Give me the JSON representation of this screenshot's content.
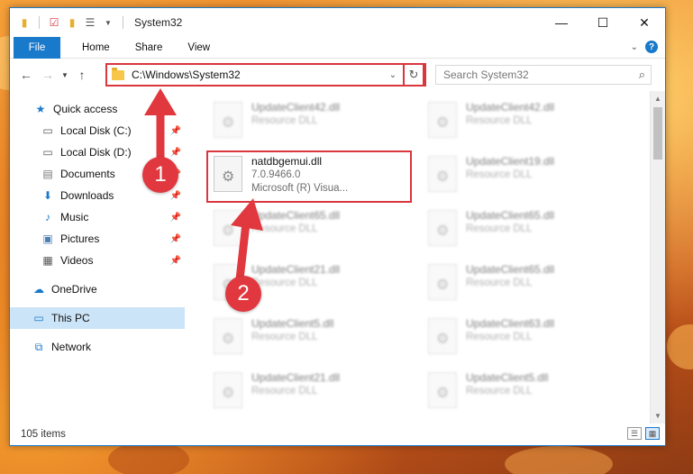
{
  "window": {
    "title": "System32",
    "controls": {
      "minimize": "—",
      "maximize": "☐",
      "close": "✕"
    }
  },
  "ribbon": {
    "file": "File",
    "tabs": [
      "Home",
      "Share",
      "View"
    ]
  },
  "address": {
    "path": "C:\\Windows\\System32",
    "search_placeholder": "Search System32"
  },
  "nav": {
    "quick_access": "Quick access",
    "items": [
      {
        "label": "Local Disk (C:)",
        "icon": "drive-icon"
      },
      {
        "label": "Local Disk (D:)",
        "icon": "drive-icon"
      },
      {
        "label": "Documents",
        "icon": "documents-icon"
      },
      {
        "label": "Downloads",
        "icon": "downloads-icon"
      },
      {
        "label": "Music",
        "icon": "music-icon"
      },
      {
        "label": "Pictures",
        "icon": "pictures-icon"
      },
      {
        "label": "Videos",
        "icon": "videos-icon"
      }
    ],
    "onedrive": "OneDrive",
    "this_pc": "This PC",
    "network": "Network"
  },
  "files": {
    "highlighted": {
      "name": "natdbgemui.dll",
      "version": "7.0.9466.0",
      "company": "Microsoft (R) Visua..."
    },
    "left_col": [
      {
        "name": "UpdateClient42.dll",
        "type": "Resource DLL"
      },
      {
        "name": "UpdateClient65.dll",
        "type": "Resource DLL"
      },
      {
        "name": "UpdateClient21.dll",
        "type": "Resource DLL"
      },
      {
        "name": "UpdateClient5.dll",
        "type": "Resource DLL"
      },
      {
        "name": "UpdateClient21.dll",
        "type": "Resource DLL"
      }
    ],
    "right_col": [
      {
        "name": "UpdateClient42.dll",
        "type": "Resource DLL"
      },
      {
        "name": "UpdateClient19.dll",
        "type": "Resource DLL"
      },
      {
        "name": "UpdateClient65.dll",
        "type": "Resource DLL"
      },
      {
        "name": "UpdateClient65.dll",
        "type": "Resource DLL"
      },
      {
        "name": "UpdateClient63.dll",
        "type": "Resource DLL"
      },
      {
        "name": "UpdateClient5.dll",
        "type": "Resource DLL"
      }
    ]
  },
  "status": {
    "count": "105 items"
  },
  "callouts": [
    "1",
    "2"
  ],
  "colors": {
    "accent": "#1979ca",
    "highlight": "#d9363e",
    "callout": "#e0383e",
    "selected": "#cce4f7"
  }
}
